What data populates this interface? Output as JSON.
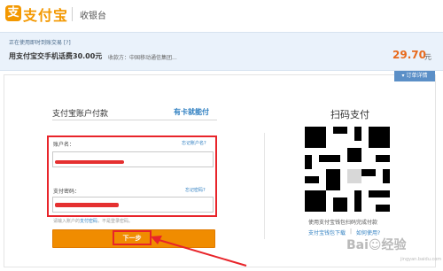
{
  "header": {
    "logo_mark": "支",
    "logo_text": "支付宝",
    "subtitle": "收银台"
  },
  "order": {
    "notice": "正在使用即时到账交易 [?]",
    "title": "用支付宝交手机话费30.00元",
    "merchant": "收款方：中国移动通信集团...",
    "amount": "29.70",
    "unit": "元",
    "detail_tab": "▾ 订单详情"
  },
  "account_pay": {
    "title": "支付宝账户付款",
    "card_link": "有卡就能付",
    "username_label": "账户名：",
    "forgot_username": "忘记账户名?",
    "password_label": "支付密码：",
    "forgot_password": "忘记密码?",
    "hint_prefix": "请输入账户的",
    "hint_strong": "支付密码",
    "hint_suffix": "，不是登录密码。",
    "next_button": "下一步"
  },
  "qr_pay": {
    "title": "扫码支付",
    "caption": "使用支付宝钱包扫码完成付款",
    "link_download": "支付宝钱包下载",
    "link_sep": "|",
    "link_howto": "如何使用?"
  },
  "watermark": {
    "brand": "Bai☺经验",
    "sub": "jingyan.baidu.com"
  },
  "colors": {
    "brand_orange": "#f39800",
    "link_blue": "#2f7fc1",
    "button_orange": "#f08c00",
    "annotation_red": "#e8242a",
    "amount_orange": "#e86a1c"
  }
}
